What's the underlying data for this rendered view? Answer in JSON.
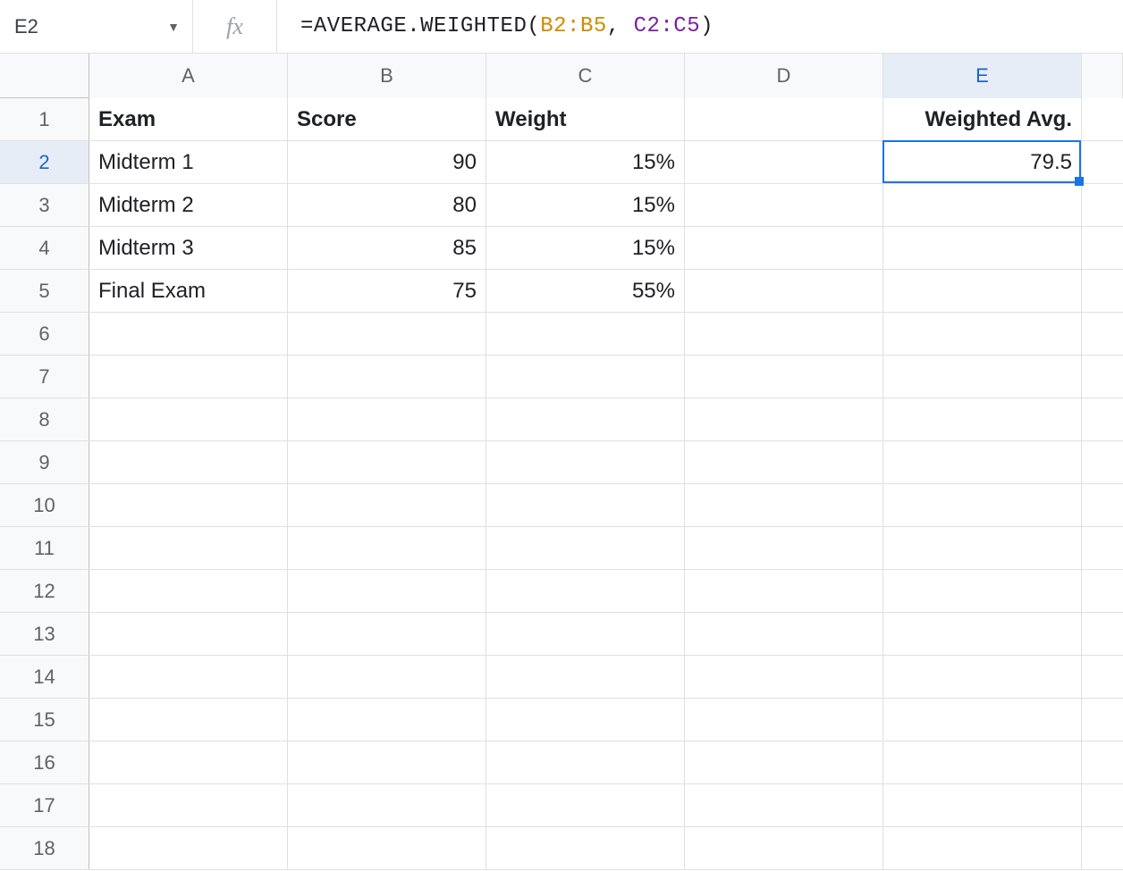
{
  "namebox": {
    "value": "E2"
  },
  "fx_label": "fx",
  "formula": {
    "prefix": "=",
    "fn": "AVERAGE.WEIGHTED",
    "open": "(",
    "range1": "B2:B5",
    "comma": ", ",
    "range2": "C2:C5",
    "close": ")"
  },
  "columns": [
    "A",
    "B",
    "C",
    "D",
    "E"
  ],
  "active_column_index": 4,
  "row_count": 18,
  "active_row": 2,
  "headers": {
    "A": "Exam",
    "B": "Score",
    "C": "Weight",
    "E": "Weighted Avg."
  },
  "data_rows": [
    {
      "A": "Midterm 1",
      "B": "90",
      "C": "15%"
    },
    {
      "A": "Midterm 2",
      "B": "80",
      "C": "15%"
    },
    {
      "A": "Midterm 3",
      "B": "85",
      "C": "15%"
    },
    {
      "A": "Final Exam",
      "B": "75",
      "C": "55%"
    }
  ],
  "result_cell": {
    "row": 2,
    "col": "E",
    "value": "79.5"
  },
  "chart_data": {
    "type": "table",
    "title": "Weighted Avg.",
    "columns": [
      "Exam",
      "Score",
      "Weight"
    ],
    "rows": [
      [
        "Midterm 1",
        90,
        0.15
      ],
      [
        "Midterm 2",
        80,
        0.15
      ],
      [
        "Midterm 3",
        85,
        0.15
      ],
      [
        "Final Exam",
        75,
        0.55
      ]
    ],
    "weighted_average": 79.5
  }
}
